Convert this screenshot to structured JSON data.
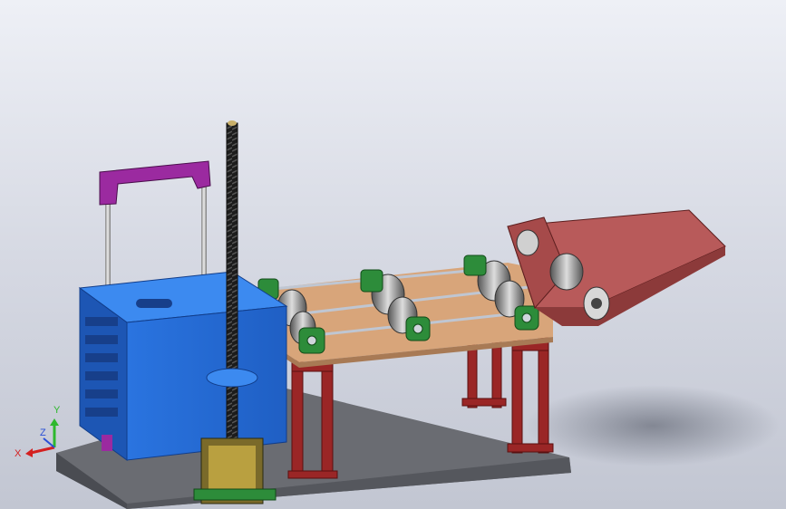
{
  "viewport": {
    "background_top": "#eef0f6",
    "background_bottom": "#c3c7d3"
  },
  "triad": {
    "x_label": "X",
    "y_label": "Y",
    "z_label": "Z",
    "x_color": "#d42020",
    "y_color": "#2eb82e",
    "z_color": "#2a4fd6"
  },
  "model": {
    "base_plate_color": "#6e7076",
    "table_top_color": "#d9a77a",
    "hopper_color": "#c86a6a",
    "housing_color": "#2f7be8",
    "handle_color": "#9b2aa0",
    "legs_color": "#9c2a2a",
    "bearing_color": "#2b8a3a",
    "screw_color": "#2a2a2a",
    "motor_color": "#9e8a3a"
  }
}
